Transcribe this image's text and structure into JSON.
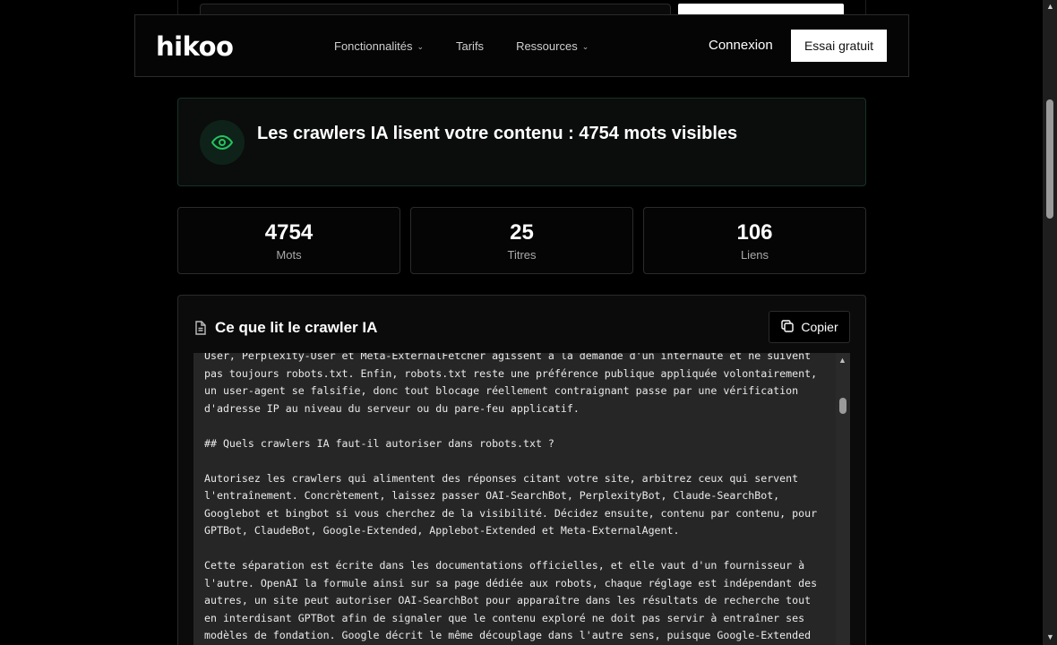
{
  "header": {
    "logo": "hikoo",
    "nav": [
      {
        "label": "Fonctionnalités",
        "has_dropdown": true
      },
      {
        "label": "Tarifs",
        "has_dropdown": false
      },
      {
        "label": "Ressources",
        "has_dropdown": true
      }
    ],
    "login_label": "Connexion",
    "trial_label": "Essai gratuit"
  },
  "banner": {
    "title": "Les crawlers IA lisent votre contenu : 4754 mots visibles",
    "icon": "eye-icon",
    "accent_color": "#22c55e"
  },
  "stats": [
    {
      "value": "4754",
      "label": "Mots"
    },
    {
      "value": "25",
      "label": "Titres"
    },
    {
      "value": "106",
      "label": "Liens"
    }
  ],
  "crawler_panel": {
    "title": "Ce que lit le crawler IA",
    "copy_label": "Copier",
    "content": "User, Perplexity-User et Meta-ExternalFetcher agissent à la demande d'un internaute et ne suivent pas toujours robots.txt. Enfin, robots.txt reste une préférence publique appliquée volontairement, un user-agent se falsifie, donc tout blocage réellement contraignant passe par une vérification d'adresse IP au niveau du serveur ou du pare-feu applicatif.\n\n## Quels crawlers IA faut-il autoriser dans robots.txt ?\n\nAutorisez les crawlers qui alimentent des réponses citant votre site, arbitrez ceux qui servent l'entraînement. Concrètement, laissez passer OAI-SearchBot, PerplexityBot, Claude-SearchBot, Googlebot et bingbot si vous cherchez de la visibilité. Décidez ensuite, contenu par contenu, pour GPTBot, ClaudeBot, Google-Extended, Applebot-Extended et Meta-ExternalAgent.\n\nCette séparation est écrite dans les documentations officielles, et elle vaut d'un fournisseur à l'autre. OpenAI la formule ainsi sur sa page dédiée aux robots, chaque réglage est indépendant des autres, un site peut autoriser OAI-SearchBot pour apparaître dans les résultats de recherche tout en interdisant GPTBot afin de signaler que le contenu exploré ne doit pas servir à entraîner ses modèles de fondation. Google décrit le même découplage dans l'autre sens, puisque Google-Extended pilote l'usage de votre contenu pour"
  }
}
